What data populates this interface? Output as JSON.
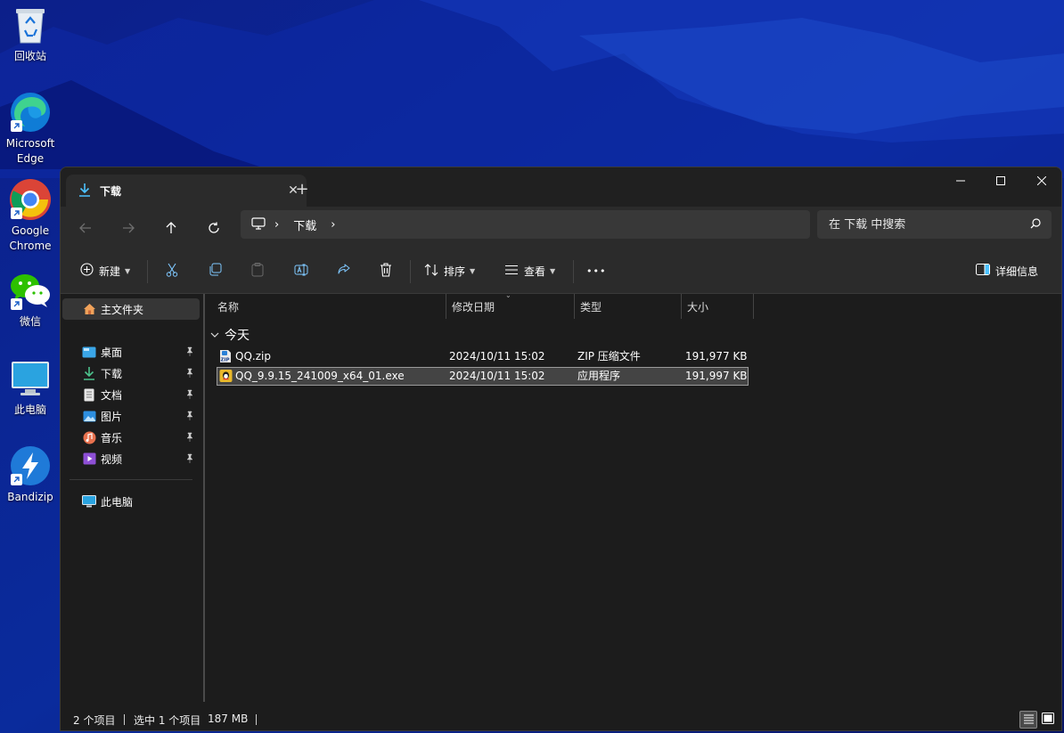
{
  "desktop": {
    "icons": [
      {
        "label": "回收站"
      },
      {
        "label": "Microsoft Edge"
      },
      {
        "label": "Google Chrome"
      },
      {
        "label": "微信"
      },
      {
        "label": "此电脑"
      },
      {
        "label": "Bandizip"
      }
    ]
  },
  "window": {
    "tab_title": "下载",
    "tab_close": "✕",
    "new_tab": "+",
    "address": {
      "root_icon": "monitor-icon",
      "segments": [
        "下载"
      ]
    },
    "search_placeholder": "在 下载 中搜索",
    "toolbar": {
      "new_label": "新建",
      "sort_label": "排序",
      "view_label": "查看",
      "more_label": "•••",
      "details_label": "详细信息"
    },
    "sidebar": {
      "home": "主文件夹",
      "quick_access": [
        {
          "label": "桌面",
          "icon": "desktop-icon"
        },
        {
          "label": "下载",
          "icon": "download-icon"
        },
        {
          "label": "文档",
          "icon": "document-icon"
        },
        {
          "label": "图片",
          "icon": "picture-icon"
        },
        {
          "label": "音乐",
          "icon": "music-icon"
        },
        {
          "label": "视频",
          "icon": "video-icon"
        }
      ],
      "this_pc": "此电脑"
    },
    "columns": {
      "name": "名称",
      "date": "修改日期",
      "type": "类型",
      "size": "大小"
    },
    "group_label": "今天",
    "files": [
      {
        "name": "QQ.zip",
        "date": "2024/10/11 15:02",
        "type": "ZIP 压缩文件",
        "size": "191,977 KB",
        "selected": false
      },
      {
        "name": "QQ_9.9.15_241009_x64_01.exe",
        "date": "2024/10/11 15:02",
        "type": "应用程序",
        "size": "191,997 KB",
        "selected": true
      }
    ],
    "status": {
      "item_count": "2 个项目",
      "selection": "选中 1 个项目",
      "selection_size": "187 MB"
    }
  },
  "colors": {
    "accent": "#4cc2ff",
    "window_bg": "#1c1c1c",
    "chrome_bg": "#2b2b2b"
  }
}
